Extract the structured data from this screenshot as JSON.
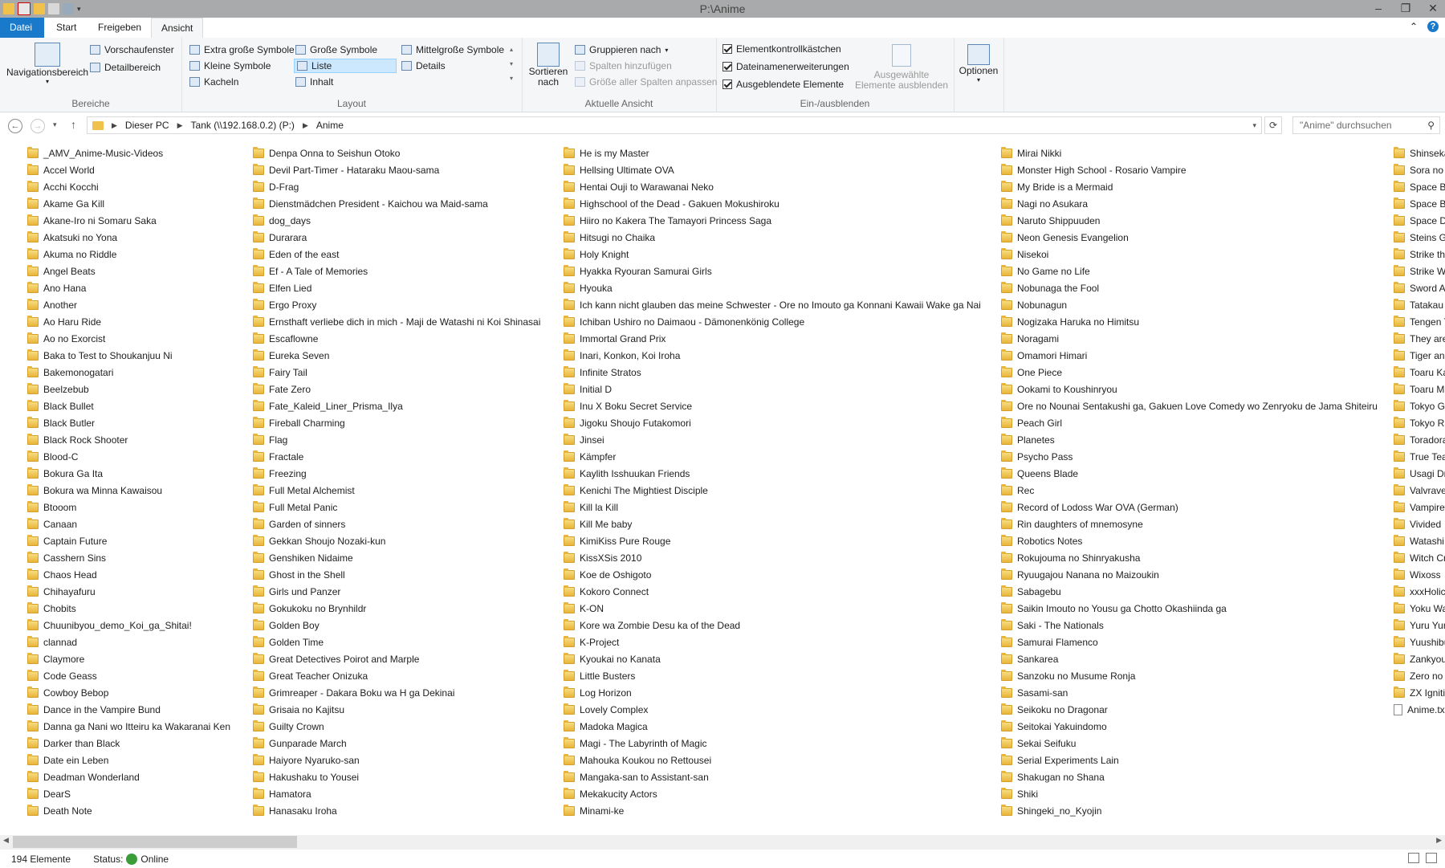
{
  "window": {
    "title": "P:\\Anime",
    "minimize": "–",
    "maximize": "❐",
    "close": "✕"
  },
  "tabs": [
    "Datei",
    "Start",
    "Freigeben",
    "Ansicht"
  ],
  "ribbon": {
    "bereiche": {
      "label": "Bereiche",
      "nav": "Navigationsbereich",
      "preview": "Vorschaufenster",
      "details": "Detailbereich"
    },
    "layout": {
      "label": "Layout",
      "options": [
        "Extra große Symbole",
        "Große Symbole",
        "Mittelgroße Symbole",
        "Kleine Symbole",
        "Liste",
        "Details",
        "Kacheln",
        "Inhalt"
      ],
      "selected": "Liste"
    },
    "aktuelle_ansicht": {
      "label": "Aktuelle Ansicht",
      "sort": "Sortieren nach",
      "group": "Gruppieren nach",
      "add_columns": "Spalten hinzufügen",
      "fit_columns": "Größe aller Spalten anpassen"
    },
    "ein_ausblenden": {
      "label": "Ein-/ausblenden",
      "checkboxes": [
        {
          "label": "Elementkontrollkästchen",
          "checked": true
        },
        {
          "label": "Dateinamenerweiterungen",
          "checked": true
        },
        {
          "label": "Ausgeblendete Elemente",
          "checked": true
        }
      ],
      "hide_selected": "Ausgewählte Elemente ausblenden"
    },
    "options": {
      "label": "Optionen"
    }
  },
  "address": {
    "path": [
      "Dieser PC",
      "Tank (\\\\192.168.0.2) (P:)",
      "Anime"
    ],
    "search_placeholder": "\"Anime\" durchsuchen"
  },
  "columns": [
    [
      "_AMV_Anime-Music-Videos",
      "Accel World",
      "Acchi Kocchi",
      "Akame Ga Kill",
      "Akane-Iro ni Somaru Saka",
      "Akatsuki no Yona",
      "Akuma no Riddle",
      "Angel Beats",
      "Ano Hana",
      "Another",
      "Ao Haru Ride",
      "Ao no Exorcist",
      "Baka to Test to Shoukanjuu Ni",
      "Bakemonogatari",
      "Beelzebub",
      "Black Bullet",
      "Black Butler",
      "Black Rock Shooter",
      "Blood-C",
      "Bokura Ga Ita",
      "Bokura wa Minna Kawaisou",
      "Btooom",
      "Canaan",
      "Captain Future",
      "Casshern Sins",
      "Chaos Head",
      "Chihayafuru",
      "Chobits",
      "Chuunibyou_demo_Koi_ga_Shitai!",
      "clannad",
      "Claymore",
      "Code Geass",
      "Cowboy Bebop",
      "Dance in the Vampire Bund",
      "Danna ga Nani wo Itteiru ka Wakaranai Ken",
      "Darker than Black",
      "Date ein Leben",
      "Deadman Wonderland",
      "DearS",
      "Death Note"
    ],
    [
      "Denpa Onna to Seishun Otoko",
      "Devil Part-Timer - Hataraku Maou-sama",
      "D-Frag",
      "Dienstmädchen President - Kaichou wa Maid-sama",
      "dog_days",
      "Durarara",
      "Eden of the east",
      "Ef - A Tale of Memories",
      "Elfen Lied",
      "Ergo Proxy",
      "Ernsthaft verliebe dich in mich - Maji de Watashi ni Koi Shinasai",
      "Escaflowne",
      "Eureka Seven",
      "Fairy Tail",
      "Fate Zero",
      "Fate_Kaleid_Liner_Prisma_Ilya",
      "Fireball Charming",
      "Flag",
      "Fractale",
      "Freezing",
      "Full Metal Alchemist",
      "Full Metal Panic",
      "Garden of sinners",
      "Gekkan Shoujo Nozaki-kun",
      "Genshiken Nidaime",
      "Ghost in the Shell",
      "Girls und Panzer",
      "Gokukoku no Brynhildr",
      "Golden Boy",
      "Golden Time",
      "Great Detectives Poirot and Marple",
      "Great Teacher Onizuka",
      "Grimreaper - Dakara Boku wa H ga Dekinai",
      "Grisaia no Kajitsu",
      "Guilty Crown",
      "Gunparade March",
      "Haiyore Nyaruko-san",
      "Hakushaku to Yousei",
      "Hamatora",
      "Hanasaku Iroha"
    ],
    [
      "He is my Master",
      "Hellsing Ultimate OVA",
      "Hentai Ouji to Warawanai Neko",
      "Highschool of the Dead - Gakuen Mokushiroku",
      "Hiiro no Kakera The Tamayori Princess Saga",
      "Hitsugi no Chaika",
      "Holy Knight",
      "Hyakka Ryouran Samurai Girls",
      "Hyouka",
      "Ich kann nicht glauben das meine Schwester - Ore no Imouto ga Konnani Kawaii Wake ga Nai",
      "Ichiban Ushiro no Daimaou - Dämonenkönig College",
      "Immortal Grand Prix",
      "Inari, Konkon, Koi Iroha",
      "Infinite Stratos",
      "Initial D",
      "Inu X Boku Secret Service",
      "Jigoku Shoujo Futakomori",
      "Jinsei",
      "Kämpfer",
      "Kaylith Isshuukan Friends",
      "Kenichi The Mightiest Disciple",
      "Kill la Kill",
      "Kill Me baby",
      "KimiKiss Pure Rouge",
      "KissXSis 2010",
      "Koe de Oshigoto",
      "Kokoro Connect",
      "K-ON",
      "Kore wa Zombie Desu ka of the Dead",
      "K-Project",
      "Kyoukai no Kanata",
      "Little Busters",
      "Log Horizon",
      "Lovely Complex",
      "Madoka Magica",
      "Magi - The Labyrinth of Magic",
      "Mahouka Koukou no Rettousei",
      "Mangaka-san to Assistant-san",
      "Mekakucity Actors",
      "Minami-ke"
    ],
    [
      "Mirai Nikki",
      "Monster High School - Rosario Vampire",
      "My Bride is a Mermaid",
      "Nagi no Asukara",
      "Naruto Shippuuden",
      "Neon Genesis Evangelion",
      "Nisekoi",
      "No Game no Life",
      "Nobunaga the Fool",
      "Nobunagun",
      "Nogizaka Haruka no Himitsu",
      "Noragami",
      "Omamori Himari",
      "One Piece",
      "Ookami to Koushinryou",
      "Ore no Nounai Sentakushi ga, Gakuen Love Comedy wo Zenryoku de Jama Shiteiru",
      "Peach Girl",
      "Planetes",
      "Psycho Pass",
      "Queens Blade",
      "Rec",
      "Record of Lodoss War OVA (German)",
      "Rin daughters of mnemosyne",
      "Robotics Notes",
      "Rokujouma no Shinryakusha",
      "Ryuugajou Nanana no Maizoukin",
      "Sabagebu",
      "Saikin Imouto no Yousu ga Chotto Okashiinda ga",
      "Saki - The Nationals",
      "Samurai Flamenco",
      "Sankarea",
      "Sanzoku no Musume Ronja",
      "Sasami-san",
      "Seikoku no Dragonar",
      "Seitokai Yakuindomo",
      "Sekai Seifuku",
      "Serial Experiments Lain",
      "Shakugan no Shana",
      "Shiki",
      "Shingeki_no_Kyojin"
    ],
    [
      "Shinseka",
      "Sora no G",
      "Space Ba",
      "Space Br",
      "Space Da",
      "Steins Ga",
      "Strike the",
      "Strike Wi",
      "Sword Ar",
      "Tatakau S",
      "Tengen T",
      "They are",
      "Tiger and",
      "Toaru Ka",
      "Toaru Ma",
      "Tokyo Gh",
      "Tokyo Ra",
      "Toradora",
      "True Tea",
      "Usagi Dro",
      "Valvrave",
      "Vampire",
      "Vivided",
      "Watashi M",
      "Witch Cr",
      "Wixoss",
      "xxxHolic",
      "Yoku Wa",
      "Yuru Yur",
      "Yuushibu",
      "Zankyou",
      "Zero no T",
      "ZX Igniti",
      "Anime.tx"
    ]
  ],
  "status": {
    "count": "194 Elemente",
    "status_label": "Status:",
    "status_value": "Online"
  }
}
